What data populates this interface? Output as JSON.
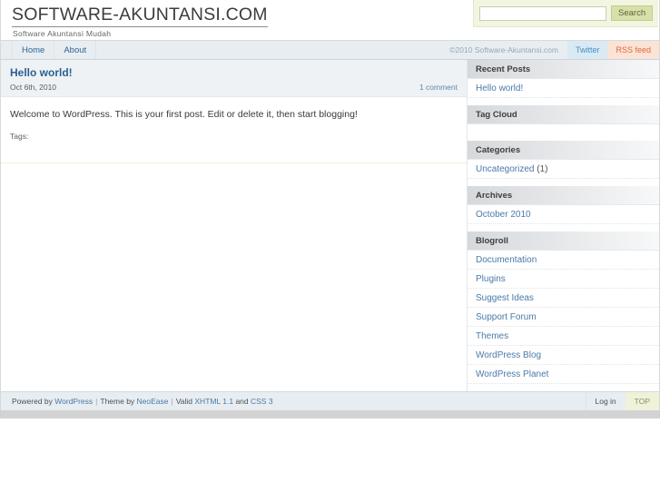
{
  "header": {
    "site_title": "SOFTWARE-AKUNTANSI.COM",
    "site_description": "Software Akuntansi Mudah",
    "search": {
      "value": "",
      "placeholder": "",
      "button_label": "Search"
    }
  },
  "nav": {
    "items": [
      {
        "label": "Home"
      },
      {
        "label": "About"
      }
    ],
    "copyright": "©2010 Software-Akuntansi.com",
    "twitter_label": "Twitter",
    "rss_label": "RSS feed"
  },
  "post": {
    "title": "Hello world!",
    "date": "Oct 6th, 2010",
    "comments": "1 comment",
    "body": "Welcome to WordPress. This is your first post. Edit or delete it, then start blogging!",
    "tags_label": "Tags:"
  },
  "sidebar": {
    "widgets": [
      {
        "title": "Recent Posts",
        "items": [
          {
            "label": "Hello world!",
            "count": ""
          }
        ]
      },
      {
        "title": "Tag Cloud",
        "items": []
      },
      {
        "title": "Categories",
        "items": [
          {
            "label": "Uncategorized",
            "count": "(1)"
          }
        ]
      },
      {
        "title": "Archives",
        "items": [
          {
            "label": "October 2010",
            "count": ""
          }
        ]
      },
      {
        "title": "Blogroll",
        "items": [
          {
            "label": "Documentation",
            "count": ""
          },
          {
            "label": "Plugins",
            "count": ""
          },
          {
            "label": "Suggest Ideas",
            "count": ""
          },
          {
            "label": "Support Forum",
            "count": ""
          },
          {
            "label": "Themes",
            "count": ""
          },
          {
            "label": "WordPress Blog",
            "count": ""
          },
          {
            "label": "WordPress Planet",
            "count": ""
          }
        ]
      }
    ]
  },
  "footer": {
    "powered_by_text": "Powered by",
    "wordpress_link": "WordPress",
    "theme_by_text": "Theme by",
    "theme_link": "NeoEase",
    "valid_text": "Valid",
    "xhtml_link": "XHTML 1.1",
    "and_text": "and",
    "css_link": "CSS 3",
    "separator": "|",
    "login_label": "Log in",
    "top_label": "TOP"
  },
  "colors": {
    "accent_link": "#4a7aa8",
    "nav_bg": "#e8edf1",
    "search_bg": "#f2f5e0",
    "rss_bg": "#fbe3d6",
    "twitter_bg": "#d9eaf4",
    "top_bg": "#eff2d8"
  }
}
